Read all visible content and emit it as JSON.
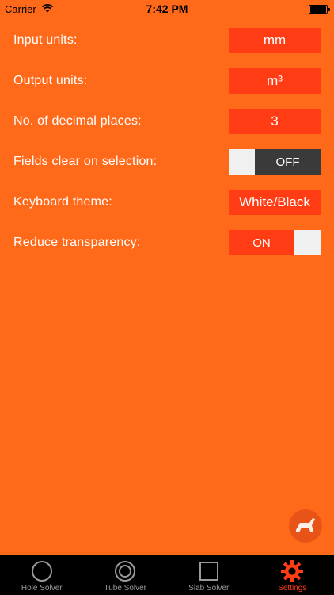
{
  "status_bar": {
    "carrier": "Carrier",
    "time": "7:42 PM"
  },
  "settings": [
    {
      "label": "Input units:",
      "value": "mm"
    },
    {
      "label": "Output units:",
      "value": "m³"
    },
    {
      "label": "No. of decimal places:",
      "value": "3"
    },
    {
      "label": "Fields clear on selection:",
      "value": "OFF"
    },
    {
      "label": "Keyboard theme:",
      "value": "White/Black"
    },
    {
      "label": "Reduce transparency:",
      "value": "ON"
    }
  ],
  "tabs": [
    {
      "label": "Hole Solver",
      "icon": "circle-icon"
    },
    {
      "label": "Tube Solver",
      "icon": "ring-icon"
    },
    {
      "label": "Slab Solver",
      "icon": "square-icon"
    },
    {
      "label": "Settings",
      "icon": "gear-icon",
      "active": true
    }
  ],
  "colors": {
    "background": "#FF6A1A",
    "value_box": "#FF3C14",
    "toggle_off": "#3A3A3A",
    "tab_active": "#FF3C14",
    "tab_inactive": "#9A9A9A"
  }
}
